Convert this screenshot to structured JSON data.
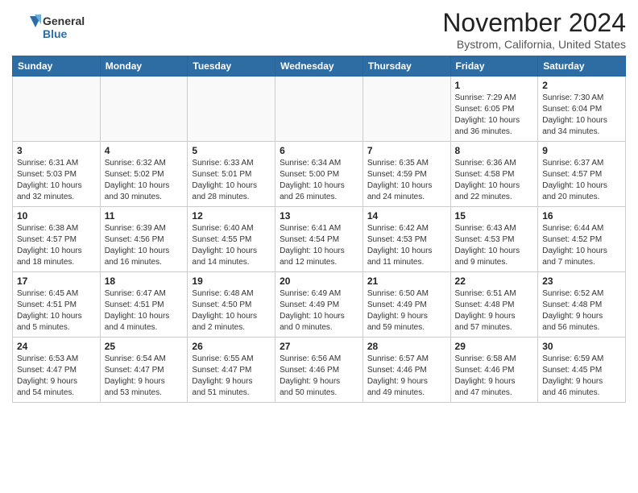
{
  "header": {
    "logo_line1": "General",
    "logo_line2": "Blue",
    "title": "November 2024",
    "subtitle": "Bystrom, California, United States"
  },
  "days_of_week": [
    "Sunday",
    "Monday",
    "Tuesday",
    "Wednesday",
    "Thursday",
    "Friday",
    "Saturday"
  ],
  "weeks": [
    [
      {
        "day": "",
        "info": ""
      },
      {
        "day": "",
        "info": ""
      },
      {
        "day": "",
        "info": ""
      },
      {
        "day": "",
        "info": ""
      },
      {
        "day": "",
        "info": ""
      },
      {
        "day": "1",
        "info": "Sunrise: 7:29 AM\nSunset: 6:05 PM\nDaylight: 10 hours\nand 36 minutes."
      },
      {
        "day": "2",
        "info": "Sunrise: 7:30 AM\nSunset: 6:04 PM\nDaylight: 10 hours\nand 34 minutes."
      }
    ],
    [
      {
        "day": "3",
        "info": "Sunrise: 6:31 AM\nSunset: 5:03 PM\nDaylight: 10 hours\nand 32 minutes."
      },
      {
        "day": "4",
        "info": "Sunrise: 6:32 AM\nSunset: 5:02 PM\nDaylight: 10 hours\nand 30 minutes."
      },
      {
        "day": "5",
        "info": "Sunrise: 6:33 AM\nSunset: 5:01 PM\nDaylight: 10 hours\nand 28 minutes."
      },
      {
        "day": "6",
        "info": "Sunrise: 6:34 AM\nSunset: 5:00 PM\nDaylight: 10 hours\nand 26 minutes."
      },
      {
        "day": "7",
        "info": "Sunrise: 6:35 AM\nSunset: 4:59 PM\nDaylight: 10 hours\nand 24 minutes."
      },
      {
        "day": "8",
        "info": "Sunrise: 6:36 AM\nSunset: 4:58 PM\nDaylight: 10 hours\nand 22 minutes."
      },
      {
        "day": "9",
        "info": "Sunrise: 6:37 AM\nSunset: 4:57 PM\nDaylight: 10 hours\nand 20 minutes."
      }
    ],
    [
      {
        "day": "10",
        "info": "Sunrise: 6:38 AM\nSunset: 4:57 PM\nDaylight: 10 hours\nand 18 minutes."
      },
      {
        "day": "11",
        "info": "Sunrise: 6:39 AM\nSunset: 4:56 PM\nDaylight: 10 hours\nand 16 minutes."
      },
      {
        "day": "12",
        "info": "Sunrise: 6:40 AM\nSunset: 4:55 PM\nDaylight: 10 hours\nand 14 minutes."
      },
      {
        "day": "13",
        "info": "Sunrise: 6:41 AM\nSunset: 4:54 PM\nDaylight: 10 hours\nand 12 minutes."
      },
      {
        "day": "14",
        "info": "Sunrise: 6:42 AM\nSunset: 4:53 PM\nDaylight: 10 hours\nand 11 minutes."
      },
      {
        "day": "15",
        "info": "Sunrise: 6:43 AM\nSunset: 4:53 PM\nDaylight: 10 hours\nand 9 minutes."
      },
      {
        "day": "16",
        "info": "Sunrise: 6:44 AM\nSunset: 4:52 PM\nDaylight: 10 hours\nand 7 minutes."
      }
    ],
    [
      {
        "day": "17",
        "info": "Sunrise: 6:45 AM\nSunset: 4:51 PM\nDaylight: 10 hours\nand 5 minutes."
      },
      {
        "day": "18",
        "info": "Sunrise: 6:47 AM\nSunset: 4:51 PM\nDaylight: 10 hours\nand 4 minutes."
      },
      {
        "day": "19",
        "info": "Sunrise: 6:48 AM\nSunset: 4:50 PM\nDaylight: 10 hours\nand 2 minutes."
      },
      {
        "day": "20",
        "info": "Sunrise: 6:49 AM\nSunset: 4:49 PM\nDaylight: 10 hours\nand 0 minutes."
      },
      {
        "day": "21",
        "info": "Sunrise: 6:50 AM\nSunset: 4:49 PM\nDaylight: 9 hours\nand 59 minutes."
      },
      {
        "day": "22",
        "info": "Sunrise: 6:51 AM\nSunset: 4:48 PM\nDaylight: 9 hours\nand 57 minutes."
      },
      {
        "day": "23",
        "info": "Sunrise: 6:52 AM\nSunset: 4:48 PM\nDaylight: 9 hours\nand 56 minutes."
      }
    ],
    [
      {
        "day": "24",
        "info": "Sunrise: 6:53 AM\nSunset: 4:47 PM\nDaylight: 9 hours\nand 54 minutes."
      },
      {
        "day": "25",
        "info": "Sunrise: 6:54 AM\nSunset: 4:47 PM\nDaylight: 9 hours\nand 53 minutes."
      },
      {
        "day": "26",
        "info": "Sunrise: 6:55 AM\nSunset: 4:47 PM\nDaylight: 9 hours\nand 51 minutes."
      },
      {
        "day": "27",
        "info": "Sunrise: 6:56 AM\nSunset: 4:46 PM\nDaylight: 9 hours\nand 50 minutes."
      },
      {
        "day": "28",
        "info": "Sunrise: 6:57 AM\nSunset: 4:46 PM\nDaylight: 9 hours\nand 49 minutes."
      },
      {
        "day": "29",
        "info": "Sunrise: 6:58 AM\nSunset: 4:46 PM\nDaylight: 9 hours\nand 47 minutes."
      },
      {
        "day": "30",
        "info": "Sunrise: 6:59 AM\nSunset: 4:45 PM\nDaylight: 9 hours\nand 46 minutes."
      }
    ]
  ]
}
